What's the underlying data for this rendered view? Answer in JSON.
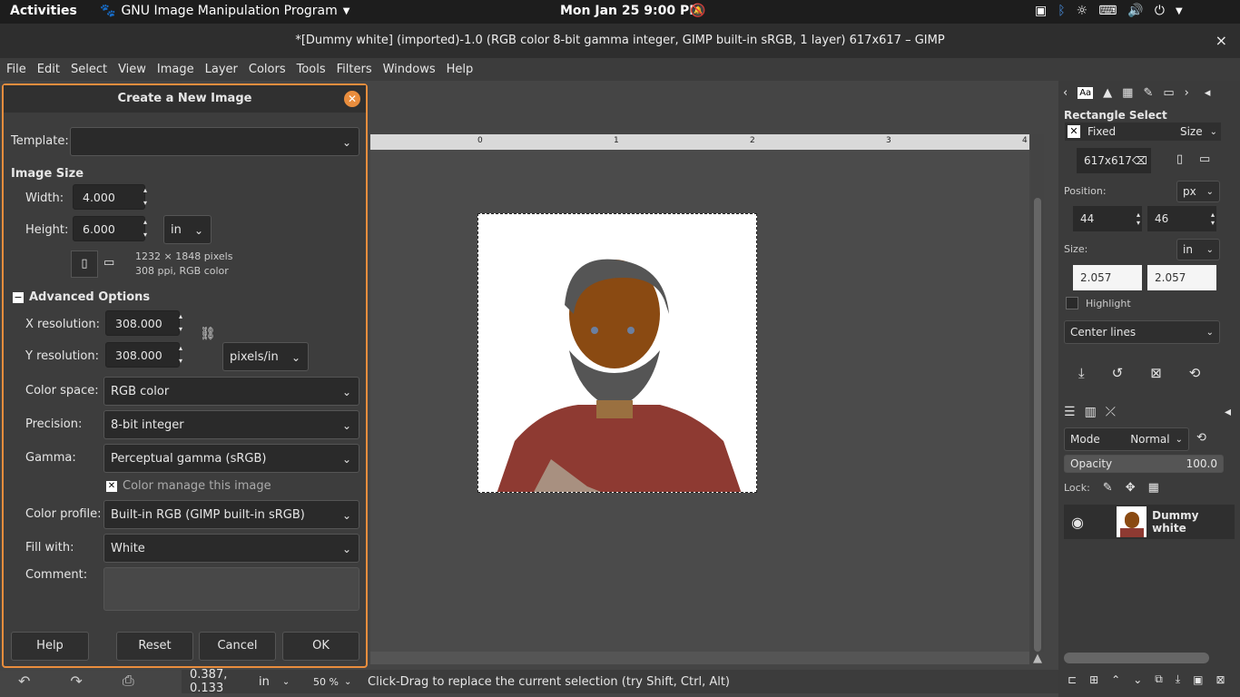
{
  "system_bar": {
    "activities": "Activities",
    "app_menu": "GNU Image Manipulation Program",
    "clock": "Mon Jan 25   9:00 PM"
  },
  "window": {
    "title": "*[Dummy white] (imported)-1.0 (RGB color 8-bit gamma integer, GIMP built-in sRGB, 1 layer) 617x617 – GIMP",
    "close": "×"
  },
  "menubar": [
    "File",
    "Edit",
    "Select",
    "View",
    "Image",
    "Layer",
    "Colors",
    "Tools",
    "Filters",
    "Windows",
    "Help"
  ],
  "ruler_ticks": [
    "0",
    "1",
    "2",
    "3",
    "4"
  ],
  "status": {
    "coords": "0.387, 0.133",
    "unit": "in",
    "zoom": "50 %",
    "message": "Click-Drag to replace the current selection (try Shift, Ctrl, Alt)"
  },
  "dialog": {
    "title": "Create a New Image",
    "template_label": "Template:",
    "template_value": "",
    "image_size_label": "Image Size",
    "width_label": "Width:",
    "width_value": "4.000",
    "height_label": "Height:",
    "height_value": "6.000",
    "size_unit": "in",
    "pixels_info": "1232 × 1848 pixels",
    "ppi_info": "308 ppi, RGB color",
    "advanced_label": "Advanced Options",
    "xres_label": "X resolution:",
    "xres_value": "308.000",
    "yres_label": "Y resolution:",
    "yres_value": "308.000",
    "res_unit": "pixels/in",
    "colorspace_label": "Color space:",
    "colorspace_value": "RGB color",
    "precision_label": "Precision:",
    "precision_value": "8-bit integer",
    "gamma_label": "Gamma:",
    "gamma_value": "Perceptual gamma (sRGB)",
    "colormanage_label": "Color manage this image",
    "profile_label": "Color profile:",
    "profile_value": "Built-in RGB (GIMP built-in sRGB)",
    "fill_label": "Fill with:",
    "fill_value": "White",
    "comment_label": "Comment:",
    "help_btn": "Help",
    "reset_btn": "Reset",
    "cancel_btn": "Cancel",
    "ok_btn": "OK"
  },
  "tool_options": {
    "tool_name": "Rectangle Select",
    "fixed_label": "Fixed",
    "fixed_mode": "Size",
    "fixed_value": "617x617",
    "position_label": "Position:",
    "position_unit": "px",
    "pos_x": "44",
    "pos_y": "46",
    "size_label": "Size:",
    "size_unit": "in",
    "size_w": "2.057",
    "size_h": "2.057",
    "highlight_label": "Highlight",
    "guides_value": "Center lines"
  },
  "layers": {
    "mode_label": "Mode",
    "mode_value": "Normal",
    "opacity_label": "Opacity",
    "opacity_value": "100.0",
    "lock_label": "Lock:",
    "layer_name": "Dummy white"
  },
  "colors": {
    "accent": "#e98d3d",
    "panel": "#3d3d3d",
    "topbar": "#1d1d1d"
  }
}
